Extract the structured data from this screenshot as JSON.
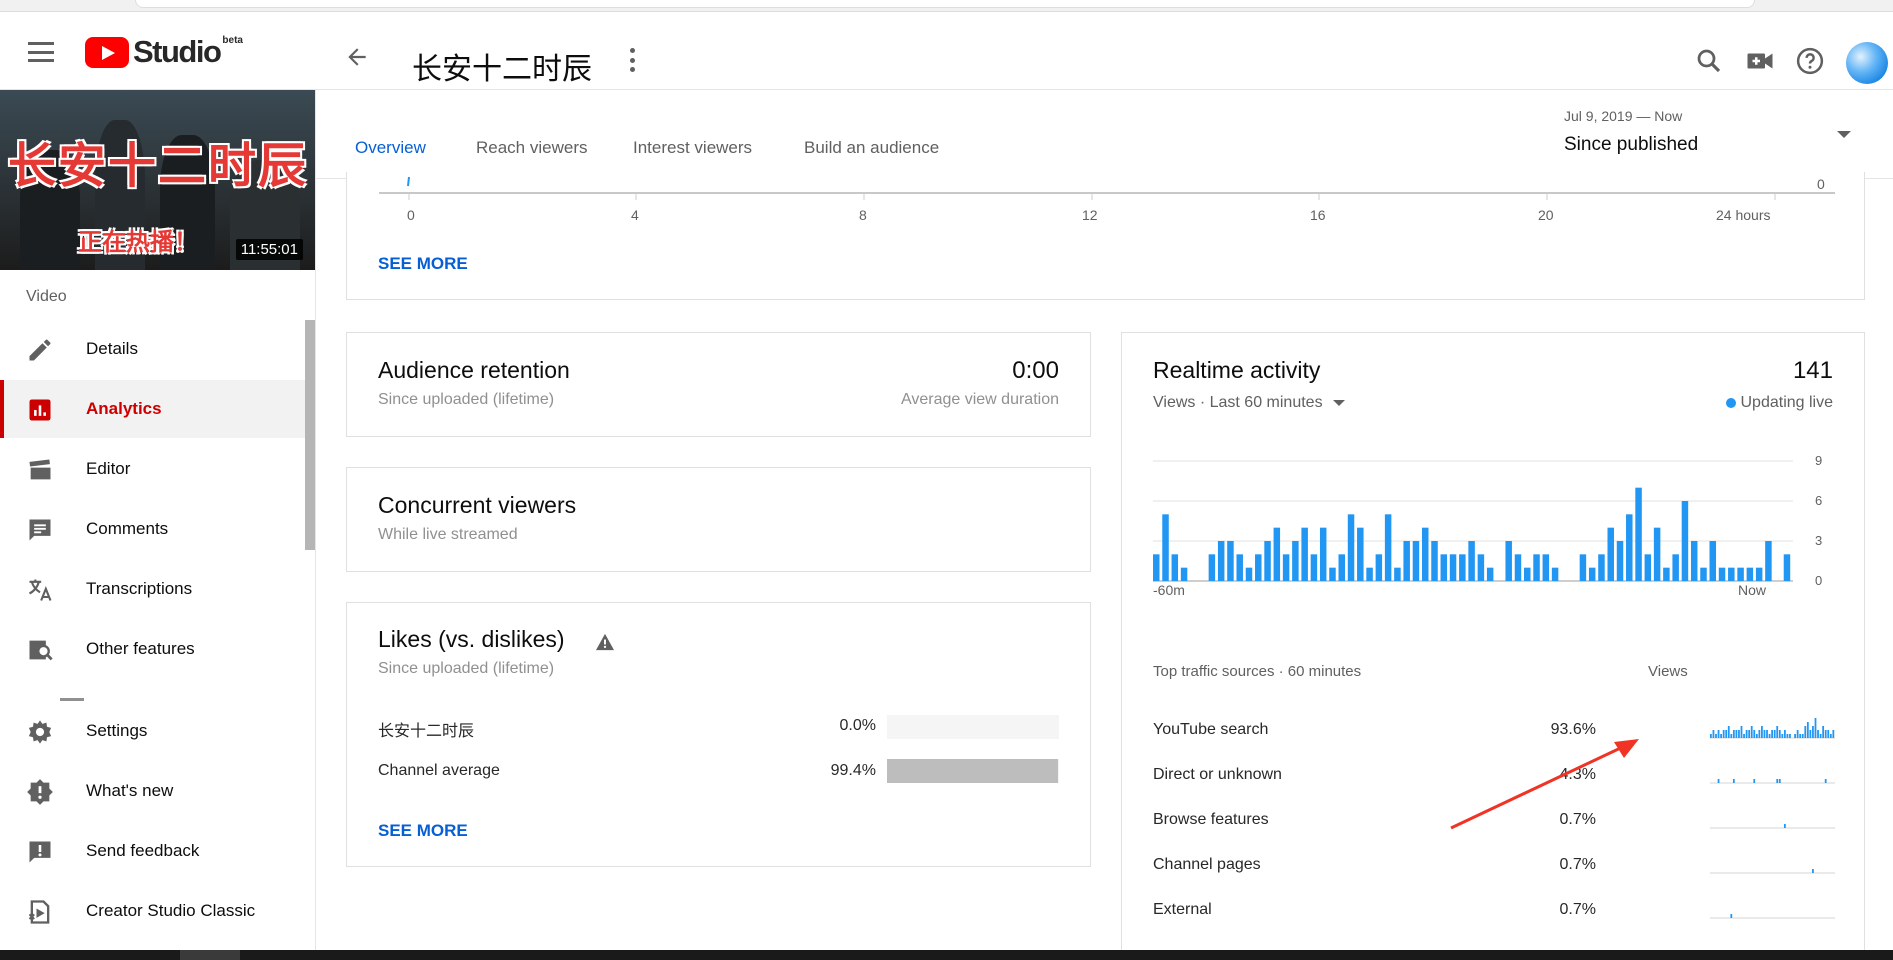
{
  "header": {
    "logo_text": "Studio",
    "logo_badge": "beta",
    "video_title": "长安十二时辰"
  },
  "sidebar": {
    "thumbnail": {
      "title_art": "长安十二时辰",
      "subtitle_art": "正在热播！",
      "duration": "11:55:01"
    },
    "section_label": "Video",
    "items": [
      {
        "label": "Details",
        "icon": "pencil-icon"
      },
      {
        "label": "Analytics",
        "icon": "analytics-icon"
      },
      {
        "label": "Editor",
        "icon": "film-icon"
      },
      {
        "label": "Comments",
        "icon": "comment-icon"
      },
      {
        "label": "Transcriptions",
        "icon": "translate-icon"
      },
      {
        "label": "Other features",
        "icon": "other-features-icon"
      }
    ],
    "bottom_items": [
      {
        "label": "Settings",
        "icon": "gear-icon"
      },
      {
        "label": "What's new",
        "icon": "whats-new-icon"
      },
      {
        "label": "Send feedback",
        "icon": "feedback-icon"
      },
      {
        "label": "Creator Studio Classic",
        "icon": "classic-icon"
      }
    ]
  },
  "tabs": {
    "items": [
      "Overview",
      "Reach viewers",
      "Interest viewers",
      "Build an audience"
    ],
    "active": "Overview",
    "date_range_sub": "Jul 9, 2019 — Now",
    "date_range_main": "Since published"
  },
  "top_card": {
    "x_ticks": [
      "0",
      "4",
      "8",
      "12",
      "16",
      "20",
      "24 hours"
    ],
    "y_tick": "0",
    "see_more": "SEE MORE"
  },
  "retention": {
    "title": "Audience retention",
    "subtitle": "Since uploaded (lifetime)",
    "value": "0:00",
    "value_label": "Average view duration"
  },
  "concurrent": {
    "title": "Concurrent viewers",
    "subtitle": "While live streamed"
  },
  "likes": {
    "title": "Likes (vs. dislikes)",
    "subtitle": "Since uploaded (lifetime)",
    "rows": [
      {
        "label": "长安十二时辰",
        "value": "0.0%",
        "fraction": 0.0
      },
      {
        "label": "Channel average",
        "value": "99.4%",
        "fraction": 0.994
      }
    ],
    "see_more": "SEE MORE"
  },
  "realtime": {
    "title": "Realtime activity",
    "total": "141",
    "metric_selector": "Views · Last 60 minutes",
    "status": "Updating live",
    "colors": {
      "bar": "#2196f3",
      "live_dot": "#2196f3"
    },
    "traffic_header": "Top traffic sources · 60 minutes",
    "traffic_col": "Views",
    "sources": [
      {
        "label": "YouTube search",
        "value": "93.6%"
      },
      {
        "label": "Direct or unknown",
        "value": "4.3%"
      },
      {
        "label": "Browse features",
        "value": "0.7%"
      },
      {
        "label": "Channel pages",
        "value": "0.7%"
      },
      {
        "label": "External",
        "value": "0.7%"
      }
    ]
  },
  "chart_data": {
    "type": "bar",
    "title": "Realtime activity",
    "xlabel": "",
    "ylabel": "Views",
    "x_tick_labels": [
      "-60m",
      "Now"
    ],
    "y_ticks": [
      0,
      3,
      6,
      9
    ],
    "ylim": [
      0,
      9
    ],
    "grid": true,
    "values": [
      2,
      5,
      2,
      1,
      0,
      0,
      2,
      3,
      3,
      2,
      1,
      2,
      3,
      4,
      2,
      3,
      4,
      2,
      4,
      1,
      2,
      5,
      4,
      1,
      2,
      5,
      1,
      3,
      3,
      4,
      3,
      2,
      2,
      2,
      3,
      2,
      1,
      0,
      3,
      2,
      1,
      2,
      2,
      1,
      0,
      0,
      2,
      1,
      2,
      4,
      3,
      5,
      7,
      2,
      4,
      1,
      2,
      6,
      3,
      1,
      3,
      1,
      1,
      1,
      1,
      1,
      3,
      0,
      2
    ]
  }
}
